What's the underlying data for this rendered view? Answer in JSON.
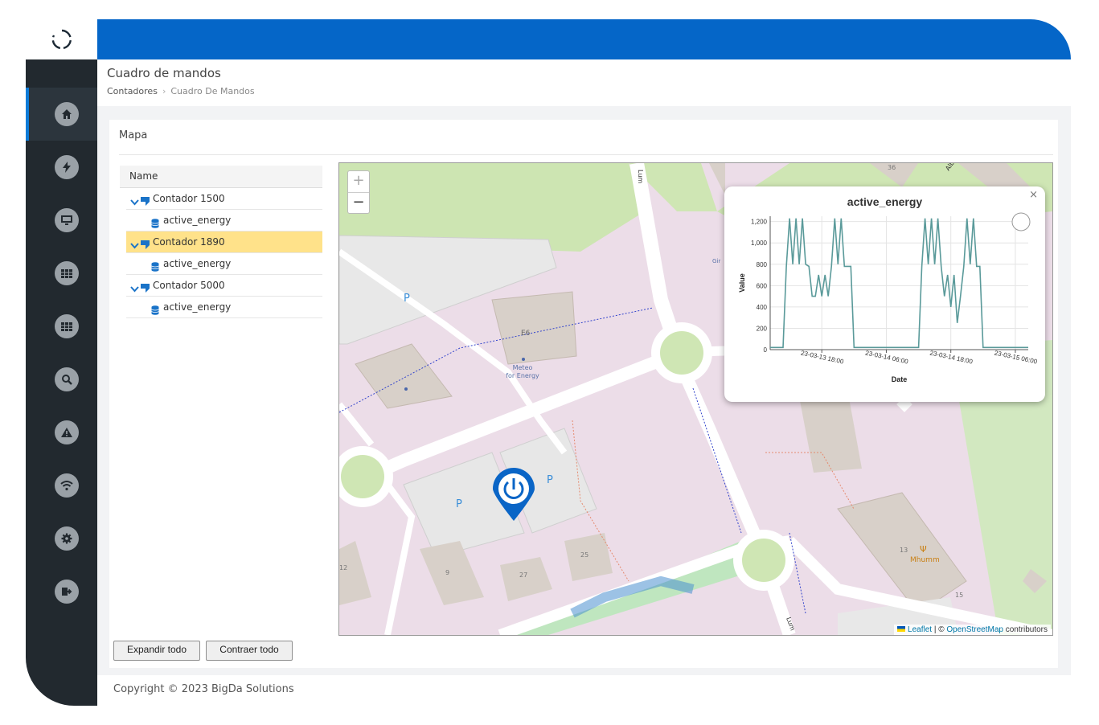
{
  "app": {
    "page_title": "Cuadro de mandos",
    "breadcrumb": [
      "Contadores",
      "Cuadro De Mandos"
    ]
  },
  "sidebar": {
    "items": [
      {
        "icon": "home-icon",
        "active": true
      },
      {
        "icon": "bolt-icon",
        "active": false
      },
      {
        "icon": "monitor-icon",
        "active": false
      },
      {
        "icon": "table-icon",
        "active": false
      },
      {
        "icon": "table-icon",
        "active": false
      },
      {
        "icon": "search-icon",
        "active": false
      },
      {
        "icon": "warning-icon",
        "active": false
      },
      {
        "icon": "wifi-icon",
        "active": false
      },
      {
        "icon": "gear-icon",
        "active": false
      },
      {
        "icon": "logout-icon",
        "active": false
      }
    ]
  },
  "card": {
    "title": "Mapa",
    "tree": {
      "header": "Name",
      "nodes": [
        {
          "label": "Contador 1500",
          "selected": false,
          "children": [
            "active_energy"
          ]
        },
        {
          "label": "Contador 1890",
          "selected": true,
          "children": [
            "active_energy"
          ]
        },
        {
          "label": "Contador 5000",
          "selected": false,
          "children": [
            "active_energy"
          ]
        }
      ]
    },
    "buttons": {
      "expand": "Expandir todo",
      "collapse": "Contraer todo"
    }
  },
  "map": {
    "zoom_in": "+",
    "zoom_out": "−",
    "labels": {
      "e6": "E6",
      "meteo1": "Meteo",
      "meteo2": "for Energy",
      "mhumm": "Mhumm",
      "n13": "13",
      "n15": "15",
      "n25": "25",
      "n27": "27",
      "n9": "9",
      "n36": "36",
      "n12": "12",
      "park": "P",
      "street1": "Lum",
      "street2": "Lum",
      "gir": "Gir",
      "alb": "Alb"
    },
    "attribution": {
      "leaflet": "Leaflet",
      "sep": " | © ",
      "osm": "OpenStreetMap",
      "suffix": " contributors"
    }
  },
  "chart_data": {
    "type": "line",
    "title": "active_energy",
    "xlabel": "Date",
    "ylabel": "Value",
    "ylim": [
      0,
      1250
    ],
    "yticks": [
      "0",
      "200",
      "400",
      "600",
      "800",
      "1,000",
      "1,200"
    ],
    "xticks": [
      "23-03-13 18:00",
      "23-03-14 06:00",
      "23-03-14 18:00",
      "23-03-15 06:00"
    ],
    "x": [
      0,
      1,
      2,
      2.5,
      3,
      3.5,
      4,
      4.5,
      5,
      5.5,
      6,
      6.5,
      7,
      7.5,
      8,
      8.5,
      9,
      9.5,
      10,
      10.5,
      11,
      11.5,
      12,
      12.5,
      13,
      13.5,
      14,
      14.5,
      15,
      16,
      17,
      18,
      19,
      20,
      21,
      22,
      23,
      23.5,
      24,
      24.5,
      25,
      25.5,
      26,
      26.5,
      27,
      27.5,
      28,
      28.5,
      29,
      29.5,
      30,
      30.5,
      31,
      31.5,
      32,
      32.5,
      33,
      33.5,
      34,
      34.5,
      35,
      36,
      37,
      38,
      39,
      40
    ],
    "values": [
      20,
      20,
      20,
      780,
      1230,
      800,
      1230,
      800,
      1230,
      800,
      780,
      500,
      500,
      700,
      500,
      700,
      500,
      780,
      1230,
      800,
      1230,
      780,
      780,
      780,
      20,
      20,
      20,
      20,
      20,
      20,
      20,
      20,
      20,
      20,
      20,
      20,
      20,
      780,
      1230,
      800,
      1230,
      800,
      1230,
      780,
      500,
      700,
      400,
      700,
      250,
      500,
      780,
      1230,
      800,
      1230,
      780,
      780,
      20,
      20,
      20,
      20,
      20,
      20,
      20,
      20,
      20,
      20
    ],
    "grid": true,
    "color": "#5a9a9a"
  }
}
